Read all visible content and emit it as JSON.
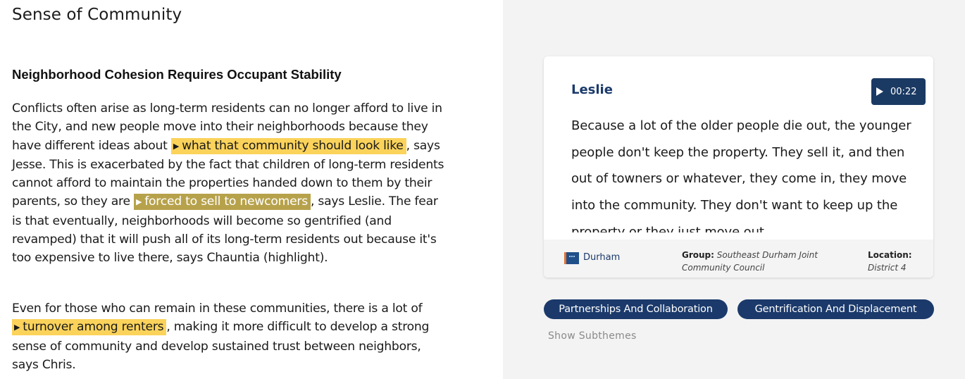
{
  "page": {
    "title": "Sense of Community"
  },
  "article": {
    "heading": "Neighborhood Cohesion Requires Occupant Stability",
    "p1": {
      "t1": "Conflicts often arise as long-term residents can no longer afford to live in the City, and new people move into their neighborhoods because they have different ideas about ",
      "h1": "what that community should look like",
      "t2": ", says Jesse. This is exacerbated by the fact that children of long-term residents cannot afford to maintain the properties handed down to them by their parents, so they are ",
      "h2": "forced to sell to newcomers",
      "t3": ", says Leslie. The fear is that eventually, neighborhoods will become so gentrified (and revamped) that it will push all of its long-term residents out because it's too expensive to live there, says Chauntia (highlight)."
    },
    "p2": {
      "t1": "Even for those who can remain in these communities, there is a lot of ",
      "h1": "turnover among renters",
      "t2": ", making it more difficult to develop a strong sense of community and develop sustained trust between neighbors, says Chris."
    }
  },
  "quote_card": {
    "speaker": "Leslie",
    "audio_duration": "00:22",
    "quote": "Because a lot of the older people die out, the younger people don't keep the property. They sell it, and then out of towners or whatever, they come in, they move into the community. They don't want to keep up the property or they just move out.",
    "footer": {
      "location_name": "Durham",
      "group_label": "Group:",
      "group_value": "Southeast Durham Joint Community Council",
      "location_label": "Location:",
      "location_value": "District 4"
    }
  },
  "tags": [
    "Partnerships And Collaboration",
    "Gentrification And Displacement"
  ],
  "show_subthemes": "Show Subthemes",
  "colors": {
    "highlight_yellow": "#fbd35b",
    "highlight_gold": "#b7a24c",
    "navy": "#1b3a6b",
    "right_panel_bg": "#f3f3f3"
  }
}
